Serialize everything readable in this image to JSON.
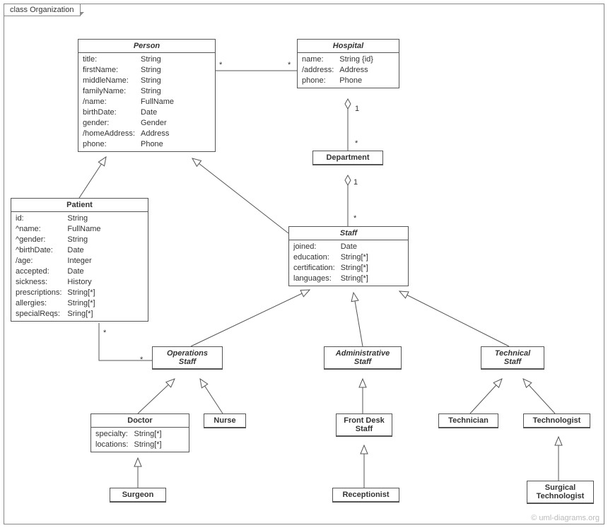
{
  "frame": {
    "label": "class Organization"
  },
  "classes": {
    "person": {
      "title": "Person",
      "attrs": [
        [
          "title:",
          "String"
        ],
        [
          "firstName:",
          "String"
        ],
        [
          "middleName:",
          "String"
        ],
        [
          "familyName:",
          "String"
        ],
        [
          "/name:",
          "FullName"
        ],
        [
          "birthDate:",
          "Date"
        ],
        [
          "gender:",
          "Gender"
        ],
        [
          "/homeAddress:",
          "Address"
        ],
        [
          "phone:",
          "Phone"
        ]
      ]
    },
    "hospital": {
      "title": "Hospital",
      "attrs": [
        [
          "name:",
          "String {id}"
        ],
        [
          "/address:",
          "Address"
        ],
        [
          "phone:",
          "Phone"
        ]
      ]
    },
    "department": {
      "title": "Department"
    },
    "patient": {
      "title": "Patient",
      "attrs": [
        [
          "id:",
          "String"
        ],
        [
          "^name:",
          "FullName"
        ],
        [
          "^gender:",
          "String"
        ],
        [
          "^birthDate:",
          "Date"
        ],
        [
          "/age:",
          "Integer"
        ],
        [
          "accepted:",
          "Date"
        ],
        [
          "sickness:",
          "History"
        ],
        [
          "prescriptions:",
          "String[*]"
        ],
        [
          "allergies:",
          "String[*]"
        ],
        [
          "specialReqs:",
          "Sring[*]"
        ]
      ]
    },
    "staff": {
      "title": "Staff",
      "attrs": [
        [
          "joined:",
          "Date"
        ],
        [
          "education:",
          "String[*]"
        ],
        [
          "certification:",
          "String[*]"
        ],
        [
          "languages:",
          "String[*]"
        ]
      ]
    },
    "opstaff": {
      "title": "Operations\nStaff"
    },
    "adminstaff": {
      "title": "Administrative\nStaff"
    },
    "techstaff": {
      "title": "Technical\nStaff"
    },
    "doctor": {
      "title": "Doctor",
      "attrs": [
        [
          "specialty:",
          "String[*]"
        ],
        [
          "locations:",
          "String[*]"
        ]
      ]
    },
    "nurse": {
      "title": "Nurse"
    },
    "frontdesk": {
      "title": "Front Desk\nStaff"
    },
    "receptionist": {
      "title": "Receptionist"
    },
    "technician": {
      "title": "Technician"
    },
    "technologist": {
      "title": "Technologist"
    },
    "surgtech": {
      "title": "Surgical\nTechnologist"
    },
    "surgeon": {
      "title": "Surgeon"
    }
  },
  "multiplicities": {
    "m1": "*",
    "m2": "*",
    "m3": "1",
    "m4": "*",
    "m5": "1",
    "m6": "*",
    "m7": "*",
    "m8": "*"
  },
  "watermark": "© uml-diagrams.org"
}
